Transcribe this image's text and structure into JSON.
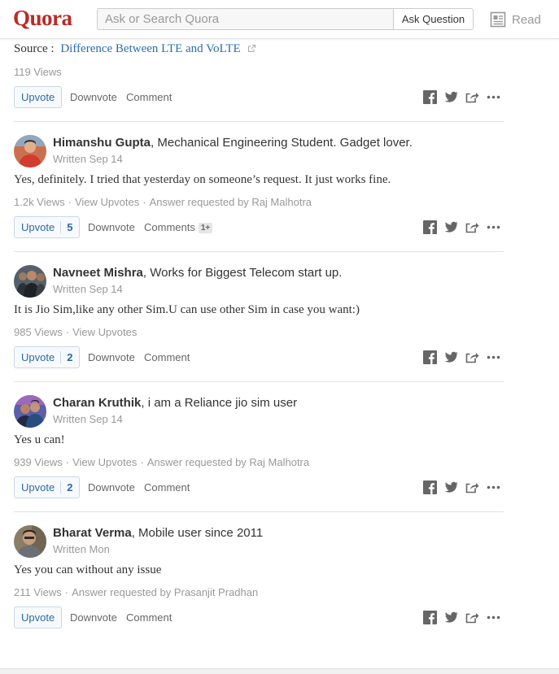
{
  "header": {
    "logo": "Quora",
    "search_placeholder": "Ask or Search Quora",
    "ask_button": "Ask Question",
    "read_label": "Read"
  },
  "top_answer": {
    "source_label": "Source :",
    "source_link": "Difference Between LTE and VoLTE",
    "views": "119 Views",
    "upvote_label": "Upvote",
    "downvote_label": "Downvote",
    "comment_label": "Comment"
  },
  "answers": [
    {
      "name": "Himanshu Gupta",
      "credential": ", Mechanical Engineering Student. Gadget lover.",
      "written": "Written Sep 14",
      "text": "Yes, definitely. I tried that yesterday on someone’s request. It just works fine.",
      "views": "1.2k Views",
      "view_upvotes": "View Upvotes",
      "requested": "Answer requested by Raj Malhotra",
      "upvote_label": "Upvote",
      "upvote_count": "5",
      "downvote_label": "Downvote",
      "comment_label": "Comments",
      "comment_badge": "1+",
      "avatar_colors": {
        "bg": "#c9714f",
        "skin": "#e0b08c",
        "shirt": "#d23b2f"
      }
    },
    {
      "name": "Navneet Mishra",
      "credential": ", Works for Biggest Telecom start up.",
      "written": "Written Sep 14",
      "text": "It is Jio Sim,like any other Sim.U can use other Sim in case you want:)",
      "views": "985 Views",
      "view_upvotes": "View Upvotes",
      "upvote_label": "Upvote",
      "upvote_count": "2",
      "downvote_label": "Downvote",
      "comment_label": "Comment",
      "avatar_colors": {
        "bg": "#55606a",
        "skin": "#b88a6a",
        "shirt": "#1e2226"
      }
    },
    {
      "name": "Charan Kruthik",
      "credential": ", i am a Reliance jio sim user",
      "written": "Written Sep 14",
      "text": "Yes u can!",
      "views": "939 Views",
      "view_upvotes": "View Upvotes",
      "requested": "Answer requested by Raj Malhotra",
      "upvote_label": "Upvote",
      "upvote_count": "2",
      "downvote_label": "Downvote",
      "comment_label": "Comment",
      "avatar_colors": {
        "bg": "#5a5fa8",
        "skin": "#c49478",
        "shirt": "#2a4d80"
      }
    },
    {
      "name": "Bharat Verma",
      "credential": ", Mobile user since 2011",
      "written": "Written Mon",
      "text": "Yes you can without any issue",
      "views": "211 Views",
      "requested": "Answer requested by Prasanjit Pradhan",
      "upvote_label": "Upvote",
      "downvote_label": "Downvote",
      "comment_label": "Comment",
      "avatar_colors": {
        "bg": "#8a7d66",
        "skin": "#c79d80",
        "shirt": "#6b6f77"
      }
    }
  ],
  "icons": [
    "facebook-icon",
    "twitter-icon",
    "share-icon",
    "more-icon",
    "external-link-icon",
    "read-icon"
  ],
  "colors": {
    "brand": "#b92b27",
    "link": "#2b6dad",
    "upvote": "#2e69a3"
  }
}
